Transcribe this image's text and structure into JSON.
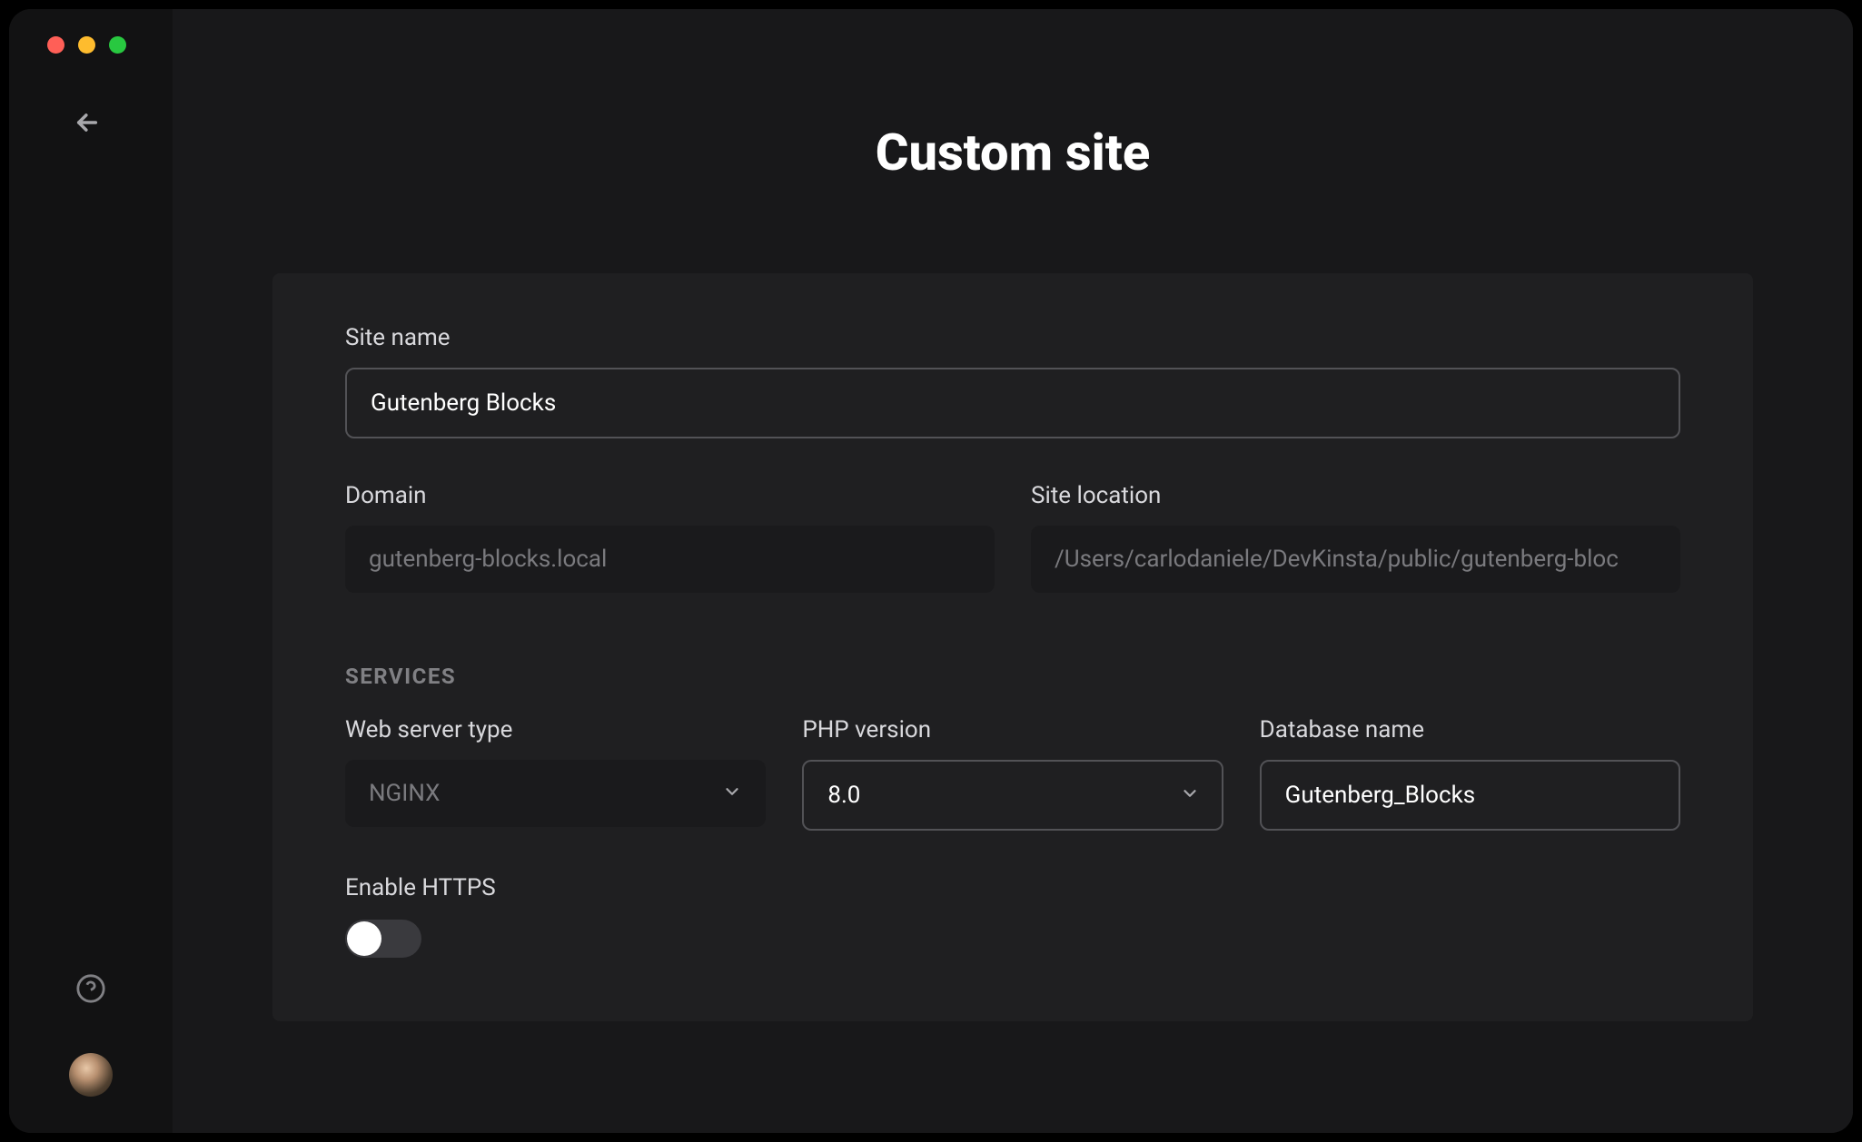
{
  "page": {
    "title": "Custom site"
  },
  "form": {
    "site_name": {
      "label": "Site name",
      "value": "Gutenberg Blocks"
    },
    "domain": {
      "label": "Domain",
      "value": "gutenberg-blocks.local"
    },
    "site_location": {
      "label": "Site location",
      "value": "/Users/carlodaniele/DevKinsta/public/gutenberg-bloc"
    },
    "services_header": "SERVICES",
    "web_server_type": {
      "label": "Web server type",
      "value": "NGINX"
    },
    "php_version": {
      "label": "PHP version",
      "value": "8.0"
    },
    "database_name": {
      "label": "Database name",
      "value": "Gutenberg_Blocks"
    },
    "enable_https": {
      "label": "Enable HTTPS",
      "enabled": false
    }
  }
}
